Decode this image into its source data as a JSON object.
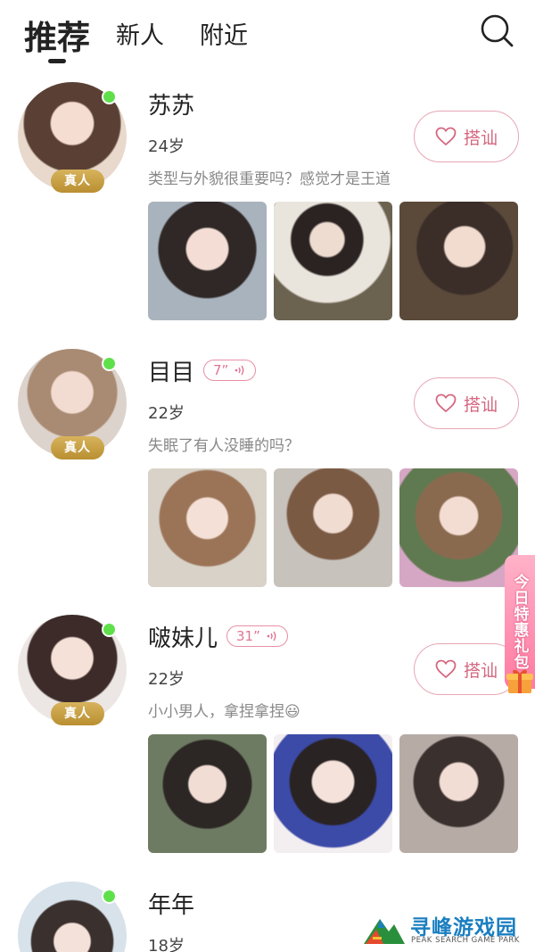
{
  "tabs": [
    {
      "label": "推荐",
      "active": true
    },
    {
      "label": "新人",
      "active": false
    },
    {
      "label": "附近",
      "active": false
    }
  ],
  "icons": {
    "search": "search-icon",
    "heart": "heart-outline-icon",
    "voice": "voice-wave-icon",
    "gift": "gift-box-icon"
  },
  "colors": {
    "accent_pink": "#d4677f",
    "online_green": "#5fe04b",
    "real_badge_gold": "#c9a24a",
    "promo_pink": "#ff7aa2"
  },
  "users": [
    {
      "name": "苏苏",
      "age": "24岁",
      "bio": "类型与外貌很重要吗？感觉才是王道",
      "badge": "真人",
      "online": true,
      "voice": "",
      "button": "搭讪"
    },
    {
      "name": "目目",
      "age": "22岁",
      "bio": "失眠了有人没睡的吗？",
      "badge": "真人",
      "online": true,
      "voice": "7”",
      "button": "搭讪"
    },
    {
      "name": "啵妹儿",
      "age": "22岁",
      "bio": "小小男人，拿捏拿捏😃",
      "badge": "真人",
      "online": true,
      "voice": "31”",
      "button": "搭讪"
    },
    {
      "name": "年年",
      "age": "18岁",
      "bio": "",
      "badge": "",
      "online": true,
      "voice": "",
      "button": ""
    }
  ],
  "promo": {
    "label": "今日特惠礼包"
  },
  "watermark": {
    "title": "寻峰游戏园",
    "subtitle": "PEAK SEARCH GAME PARK"
  }
}
